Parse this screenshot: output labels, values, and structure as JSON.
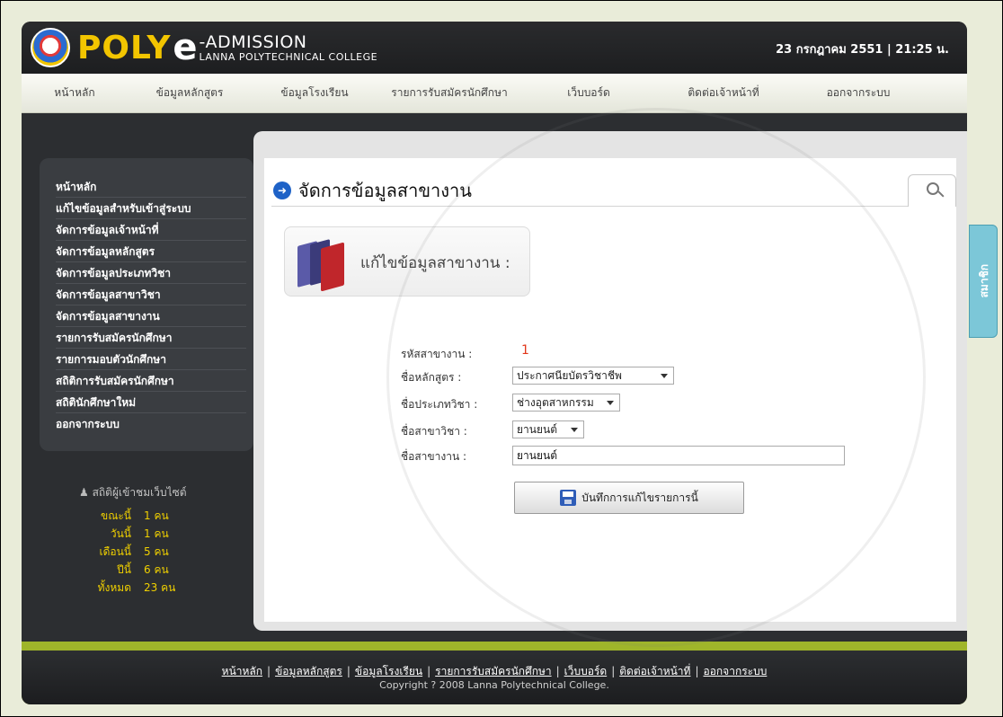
{
  "header": {
    "logo_poly": "POLY",
    "logo_e": "e",
    "logo_admission": "-ADMISSION",
    "logo_college": "LANNA POLYTECHNICAL COLLEGE",
    "datetime": "23 กรกฎาคม 2551  |  21:25 น."
  },
  "nav": {
    "items": [
      "หน้าหลัก",
      "ข้อมูลหลักสูตร",
      "ข้อมูลโรงเรียน",
      "รายการรับสมัครนักศึกษา",
      "เว็บบอร์ด",
      "ติดต่อเจ้าหน้าที่",
      "ออกจากระบบ"
    ]
  },
  "sidebar": {
    "items": [
      "หน้าหลัก",
      "แก้ไขข้อมูลสำหรับเข้าสู่ระบบ",
      "จัดการข้อมูลเจ้าหน้าที่",
      "จัดการข้อมูลหลักสูตร",
      "จัดการข้อมูลประเภทวิชา",
      "จัดการข้อมูลสาขาวิชา",
      "จัดการข้อมูลสาขางาน",
      "รายการรับสมัครนักศึกษา",
      "รายการมอบตัวนักศึกษา",
      "สถิติการรับสมัครนักศึกษา",
      "สถิตินักศึกษาใหม่",
      "ออกจากระบบ"
    ]
  },
  "stats": {
    "title": "สถิติผู้เข้าชมเว็บไซต์",
    "rows": [
      {
        "label": "ขณะนี้",
        "value": "1 คน"
      },
      {
        "label": "วันนี้",
        "value": "1 คน"
      },
      {
        "label": "เดือนนี้",
        "value": "5 คน"
      },
      {
        "label": "ปีนี้",
        "value": "6 คน"
      },
      {
        "label": "ทั้งหมด",
        "value": "23 คน"
      }
    ]
  },
  "main": {
    "title": "จัดการข้อมูลสาขางาน",
    "edit_banner": "แก้ไขข้อมูลสาขางาน :",
    "form": {
      "code_label": "รหัสสาขางาน :",
      "code_value": "1",
      "course_label": "ชื่อหลักสูตร :",
      "course_value": "ประกาศนียบัตรวิชาชีพ",
      "type_label": "ชื่อประเภทวิชา :",
      "type_value": "ช่างอุตสาหกรรม",
      "major_label": "ชื่อสาขาวิชา :",
      "major_value": "ยานยนต์",
      "work_label": "ชื่อสาขางาน :",
      "work_value": "ยานยนต์"
    },
    "save_label": "บันทึกการแก้ไขรายการนี้"
  },
  "side_tab": {
    "label": "สมาชิก"
  },
  "footer": {
    "links": [
      "หน้าหลัก",
      "ข้อมูลหลักสูตร",
      "ข้อมูลโรงเรียน",
      "รายการรับสมัครนักศึกษา",
      "เว็บบอร์ด",
      "ติดต่อเจ้าหน้าที่",
      "ออกจากระบบ"
    ],
    "copyright": "Copyright ? 2008 Lanna Polytechnical College."
  }
}
